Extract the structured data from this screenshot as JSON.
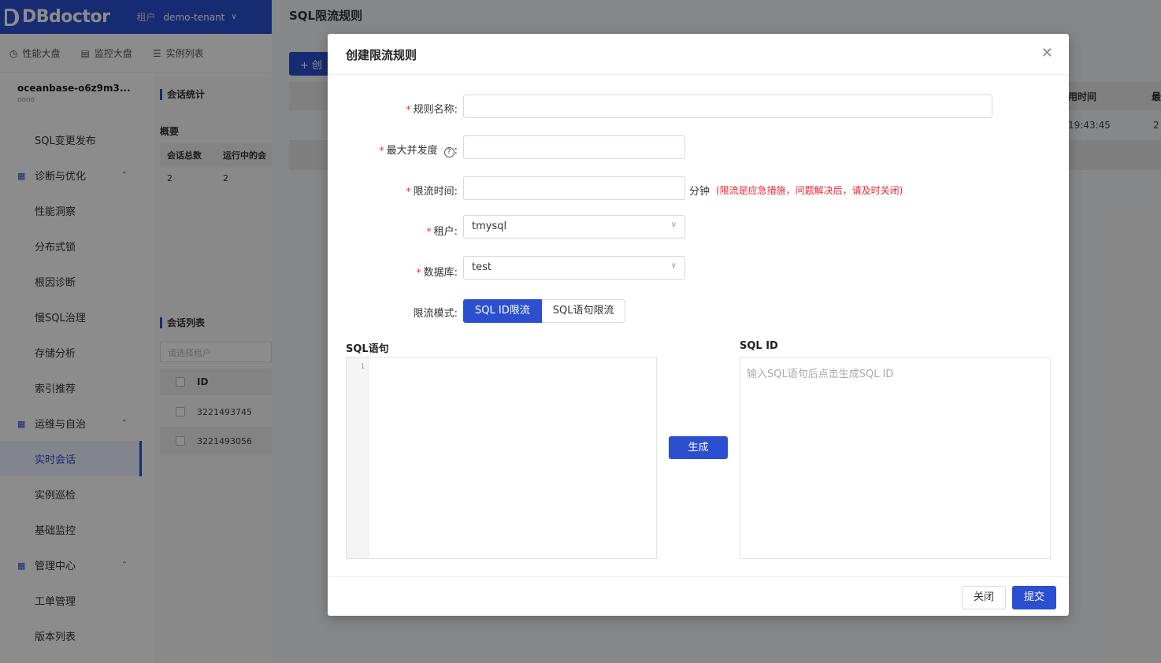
{
  "app": {
    "logo_text": "DBdoctor",
    "tenant_label": "租户",
    "tenant_name": "demo-tenant"
  },
  "top_tabs": [
    {
      "label": "性能大盘",
      "icon": "dashboard-icon"
    },
    {
      "label": "监控大盘",
      "icon": "monitor-icon"
    },
    {
      "label": "实例列表",
      "icon": "list-icon"
    }
  ],
  "instance": {
    "name": "oceanbase-o6z9m3...",
    "sub": "oooo"
  },
  "sidebar": {
    "items": [
      {
        "label": "SQL变更发布",
        "type": "item"
      },
      {
        "label": "诊断与优化",
        "type": "group"
      },
      {
        "label": "性能洞察",
        "type": "item"
      },
      {
        "label": "分布式锁",
        "type": "item"
      },
      {
        "label": "根因诊断",
        "type": "item"
      },
      {
        "label": "慢SQL治理",
        "type": "item"
      },
      {
        "label": "存储分析",
        "type": "item"
      },
      {
        "label": "索引推荐",
        "type": "item"
      },
      {
        "label": "运维与自治",
        "type": "group"
      },
      {
        "label": "实时会话",
        "type": "item",
        "active": true
      },
      {
        "label": "实例巡检",
        "type": "item"
      },
      {
        "label": "基础监控",
        "type": "item"
      },
      {
        "label": "管理中心",
        "type": "group"
      },
      {
        "label": "工单管理",
        "type": "item"
      },
      {
        "label": "版本列表",
        "type": "item"
      }
    ]
  },
  "session_panel": {
    "stats_title": "会话统计",
    "summary_label": "概要",
    "summary_headers": [
      "会话总数",
      "运行中的会"
    ],
    "summary_values": [
      "2",
      "2"
    ],
    "list_title": "会话列表",
    "select_placeholder": "请选择租户",
    "id_header": "ID",
    "rows": [
      "3221493745",
      "3221493056"
    ]
  },
  "page": {
    "title": "SQL限流规则",
    "create_button": "+ 创",
    "col_time": "用时间",
    "col_last": "最",
    "cell_time": "19:43:45",
    "cell_last": "2"
  },
  "modal": {
    "title": "创建限流规则",
    "rule_name_label": "规则名称:",
    "rule_name_value": "",
    "max_concurrency_label": "最大并发度",
    "limit_time_label": "限流时间:",
    "limit_time_unit": "分钟",
    "limit_time_warning": "(限流是应急措施，问题解决后，请及时关闭)",
    "tenant_label": "租户:",
    "tenant_value": "tmysql",
    "database_label": "数据库:",
    "database_value": "test",
    "mode_label": "限流模式:",
    "mode_options": [
      "SQL ID限流",
      "SQL语句限流"
    ],
    "mode_selected": "SQL ID限流",
    "sql_label": "SQL语句",
    "sql_line_number": "1",
    "sqlid_label": "SQL ID",
    "sqlid_placeholder": "输入SQL语句后点击生成SQL ID",
    "generate_button": "生成",
    "close_button": "关闭",
    "submit_button": "提交",
    "colors": {
      "primary": "#2b4fcf",
      "required": "#f5222d"
    }
  }
}
